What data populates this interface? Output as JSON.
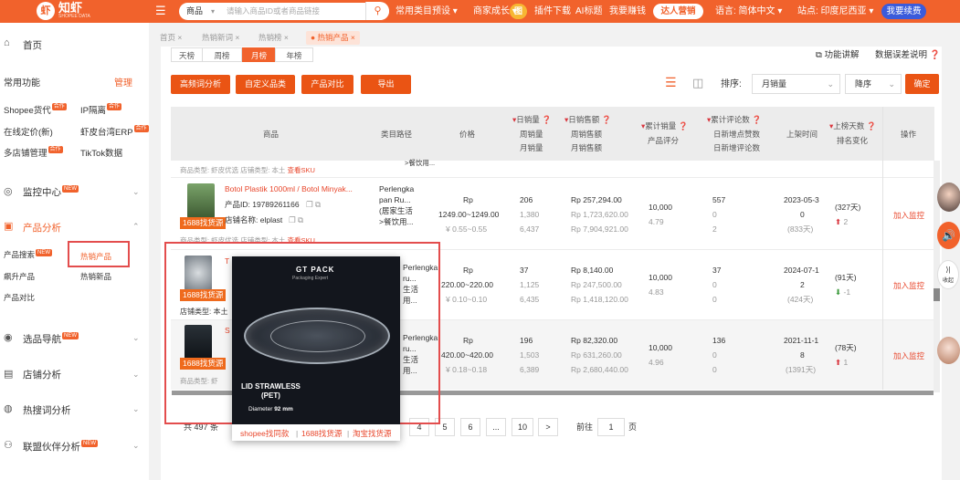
{
  "brand": {
    "name": "知虾",
    "sub": "SHOPEE DATA",
    "mark": "虾"
  },
  "search": {
    "category": "商品",
    "placeholder": "请输入商品ID或者商品链接",
    "circle_label": "图"
  },
  "topnav": {
    "item1": "常用类目预设",
    "item2": "商家成长",
    "item3": "插件下载",
    "item4": "AI标题",
    "item5": "我要赚钱",
    "promo": "达人营销",
    "lang": "语言: 简体中文",
    "site": "站点: 印度尼西亚",
    "renew": "我要续费"
  },
  "sidebar": {
    "home": "首页",
    "common": "常用功能",
    "manage": "管理",
    "c1": "Shopee货代",
    "c1_badge": "合作",
    "c2": "IP隔离",
    "c2_badge": "合作",
    "c3": "在线定价(新)",
    "c4": "虾皮台湾ERP",
    "c4_badge": "合作",
    "c5": "多店铺管理",
    "c5_badge": "合作",
    "c6": "TikTok数据",
    "monitor": "监控中心",
    "new": "NEW",
    "product": "产品分析",
    "p1": "产品搜索",
    "p2": "热销产品",
    "p3": "飙升产品",
    "p4": "热销新品",
    "p5": "产品对比",
    "select": "选品导航",
    "store": "店铺分析",
    "keyword": "热搜词分析",
    "affiliate": "联盟伙伴分析"
  },
  "breadcrumbs": {
    "b1": "首页",
    "b2": "热销新词",
    "b3": "热销榜",
    "b4": "热销产品"
  },
  "toolbar": {
    "tab_day": "天榜",
    "tab_week": "周榜",
    "tab_month": "月榜",
    "tab_year": "年榜",
    "btn1": "高频词分析",
    "btn2": "自定义品类",
    "btn3": "产品对比",
    "btn4": "导出",
    "help": "功能讲解",
    "feedback": "数据误差说明",
    "sort_label": "排序:",
    "sort_value": "月销量",
    "order_value": "降序",
    "confirm": "确定"
  },
  "table": {
    "h_product": "商品",
    "h_path": "类目路径",
    "h_price": "价格",
    "h_daysales": "日销量",
    "h_weeksales": "周销量",
    "h_monthsales": "月销量",
    "h_dayrev": "日销售额",
    "h_weekrev": "周销售额",
    "h_monthrev": "月销售额",
    "h_totalsales": "累计销量",
    "h_rating": "产品评分",
    "h_reviews": "累计评论数",
    "h_newlikes": "日新增点赞数",
    "h_newreviews": "日新增评论数",
    "h_listed": "上架时间",
    "h_days": "上榜天数",
    "h_rank": "排名变化",
    "h_op": "操作",
    "partial_top": "商品类型: 虾皮优选 店铺类型: 本土",
    "partial_top_link": "查看SKU",
    "partial_top_path": ">餐饮用...",
    "tag": "1688找货源",
    "add_monitor": "加入监控",
    "r1": {
      "title": "Botol Plastik 1000ml / Botol Minyak...",
      "pid": "产品ID: 19789261166",
      "shop": "店铺名称: elplast",
      "meta": "商品类型: 虾皮优选 店铺类型: 本土",
      "meta_link": "查看SKU",
      "path1": "Perlengka",
      "path2": "pan Ru...",
      "path3": "(居家生活",
      "path4": ">餐饮用...",
      "price": "Rp",
      "price_range": "1249.00~1249.00",
      "usd_range": "¥ 0.55~0.55",
      "s1": "206",
      "s2": "1,380",
      "s3": "6,437",
      "v1": "Rp 257,294.00",
      "v2": "Rp 1,723,620.00",
      "v3": "Rp 7,904,921.00",
      "total": "10,000",
      "rating": "4.79",
      "reviews": "557",
      "likes": "0",
      "newrev": "2",
      "date1": "2023-05-3",
      "date2": "0",
      "date3": "(833天)",
      "days": "(327天)",
      "rank": "2"
    },
    "r2": {
      "title": "T",
      "shop": "店铺类型: 本土",
      "path1": "Perlengka",
      "path2": "ru...",
      "path3": "生活",
      "path4": "用...",
      "price": "Rp",
      "price_range": "220.00~220.00",
      "usd_range": "¥ 0.10~0.10",
      "s1": "37",
      "s2": "1,125",
      "s3": "6,435",
      "v1": "Rp 8,140.00",
      "v2": "Rp 247,500.00",
      "v3": "Rp 1,418,120.00",
      "total": "10,000",
      "rating": "4.83",
      "reviews": "37",
      "likes": "0",
      "newrev": "0",
      "date1": "2024-07-1",
      "date2": "2",
      "date3": "(424天)",
      "days": "(91天)",
      "rank": "-1"
    },
    "r3": {
      "title": "S",
      "meta": "商品类型: 虾",
      "path1": "Perlengka",
      "path2": "ru...",
      "path3": "生活",
      "path4": "用...",
      "price": "Rp",
      "price_range": "420.00~420.00",
      "usd_range": "¥ 0.18~0.18",
      "s1": "196",
      "s2": "1,503",
      "s3": "6,389",
      "v1": "Rp 82,320.00",
      "v2": "Rp 631,260.00",
      "v3": "Rp 2,680,440.00",
      "total": "10,000",
      "rating": "4.96",
      "reviews": "136",
      "likes": "0",
      "newrev": "0",
      "date1": "2021-11-1",
      "date2": "8",
      "date3": "(1391天)",
      "days": "(78天)",
      "rank": "1"
    }
  },
  "popup": {
    "brand": "GT PACK",
    "brand_sub": "Packaging Expert",
    "caption1": "LID STRAWLESS",
    "caption2": "(PET)",
    "diameter_label": "Diameter",
    "diameter_value": "92 mm",
    "link1": "shopee找同款",
    "link2": "1688找货源",
    "link3": "淘宝找货源"
  },
  "pagination": {
    "total": "共 497 条",
    "p4": "4",
    "p5": "5",
    "p6": "6",
    "ellipsis": "...",
    "last": "10",
    "next": ">",
    "goto": "前往",
    "page_input": "1",
    "page_unit": "页"
  },
  "floating": {
    "fold": "收起",
    "fold_icon": "⟩|"
  }
}
